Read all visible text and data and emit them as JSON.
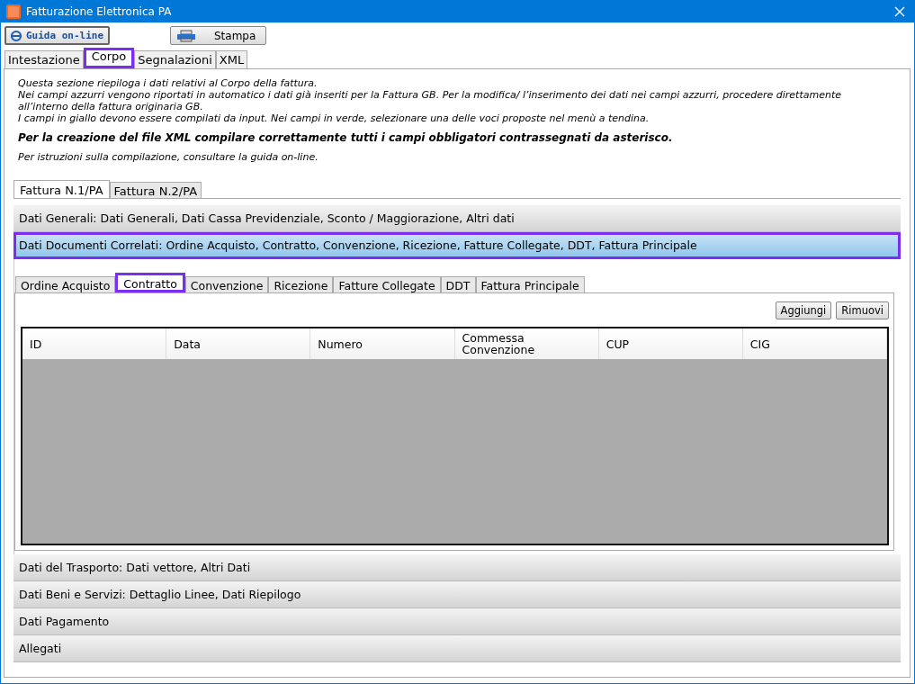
{
  "window": {
    "title": "Fatturazione Elettronica PA"
  },
  "toolbar": [
    {
      "kind": "help",
      "label": "Guida on-line"
    },
    {
      "kind": "print",
      "label": "Stampa"
    }
  ],
  "tabs": [
    {
      "label": "Intestazione",
      "selected": false
    },
    {
      "label": "Corpo",
      "selected": true
    },
    {
      "label": "Segnalazioni",
      "selected": false
    },
    {
      "label": "XML",
      "selected": false
    }
  ],
  "intro": {
    "lines": [
      "Questa sezione riepiloga i dati relativi al Corpo della fattura.",
      "Nei campi azzurri vengono riportati in automatico i dati già inseriti per la Fattura GB. Per la modifica/ l’inserimento dei dati nei campi azzurri, procedere direttamente all’interno della fattura originaria GB.",
      "I campi in giallo devono essere compilati da input. Nei campi in verde, selezionare una delle voci proposte nel menù a tendina."
    ],
    "notice": "Per la creazione del file XML compilare correttamente tutti i campi obbligatori contrassegnati da asterisco.",
    "hint": "Per istruzioni sulla compilazione, consultare la guida on-line."
  },
  "invoice_tabs": [
    {
      "label": "Fattura N.1/PA",
      "selected": true
    },
    {
      "label": "Fattura N.2/PA",
      "selected": false
    }
  ],
  "sections": [
    {
      "label": "Dati Generali: Dati Generali, Dati Cassa Previdenziale, Sconto / Maggiorazione, Altri dati",
      "selected": false
    },
    {
      "label": "Dati Documenti Correlati: Ordine Acquisto, Contratto, Convenzione, Ricezione, Fatture Collegate, DDT, Fattura Principale",
      "selected": true
    },
    {
      "label": "Dati del Trasporto: Dati vettore, Altri Dati",
      "selected": false
    },
    {
      "label": "Dati Beni e Servizi: Dettaglio Linee, Dati Riepilogo",
      "selected": false
    },
    {
      "label": "Dati Pagamento",
      "selected": false
    },
    {
      "label": "Allegati",
      "selected": false
    }
  ],
  "document_tabs": [
    {
      "label": "Ordine Acquisto",
      "selected": false
    },
    {
      "label": "Contratto",
      "selected": true
    },
    {
      "label": "Convenzione",
      "selected": false
    },
    {
      "label": "Ricezione",
      "selected": false
    },
    {
      "label": "Fatture Collegate",
      "selected": false
    },
    {
      "label": "DDT",
      "selected": false
    },
    {
      "label": "Fattura Principale",
      "selected": false
    }
  ],
  "actions": [
    "Aggiungi",
    "Rimuovi"
  ],
  "table": {
    "columns": [
      "ID",
      "Data",
      "Numero",
      "Commessa Convenzione",
      "CUP",
      "CIG"
    ]
  }
}
